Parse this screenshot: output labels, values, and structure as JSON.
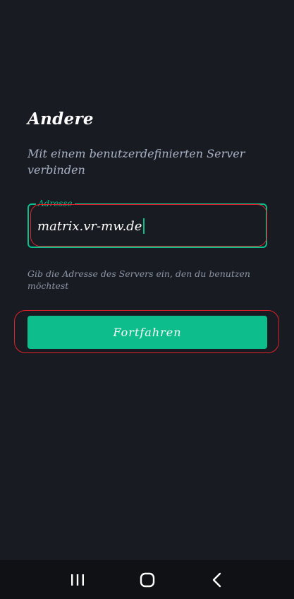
{
  "header": {
    "title": "Andere",
    "subtitle": "Mit einem benutzerdefinierten Server verbinden"
  },
  "address_field": {
    "label": "Adresse",
    "value": "matrix.vr-mw.de",
    "helper": "Gib die Adresse des Servers ein, den du benutzen möchtest"
  },
  "actions": {
    "continue_label": "Fortfahren"
  },
  "navbar": {
    "icons": [
      "recent-apps-icon",
      "home-icon",
      "back-icon"
    ]
  },
  "colors": {
    "background": "#181b21",
    "accent": "#0dbd8b",
    "highlight": "#e1212b"
  }
}
